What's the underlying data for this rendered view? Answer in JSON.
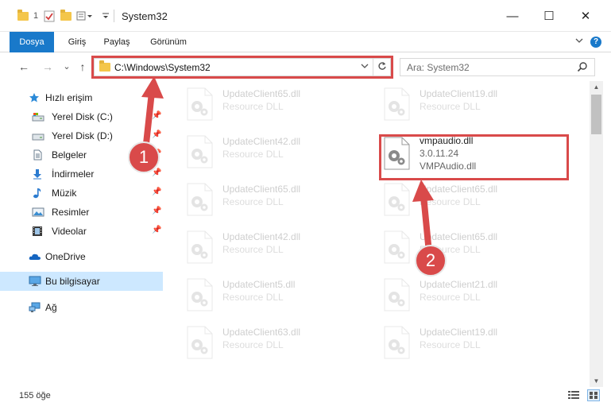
{
  "window": {
    "title": "System32",
    "quick_access_count": "1",
    "minimize_symbol": "—",
    "maximize_symbol": "☐",
    "close_symbol": "✕"
  },
  "ribbon": {
    "tabs": [
      "Dosya",
      "Giriş",
      "Paylaş",
      "Görünüm"
    ],
    "help_symbol": "?"
  },
  "navigation": {
    "back_symbol": "←",
    "forward_symbol": "→",
    "recent_symbol": "⌄",
    "up_symbol": "↑",
    "address": "C:\\Windows\\System32",
    "search_placeholder": "Ara: System32"
  },
  "sidebar": {
    "items": [
      {
        "label": "Hızlı erişim",
        "icon": "star-icon"
      },
      {
        "label": "Yerel Disk (C:)",
        "icon": "drive-icon",
        "pinned": true
      },
      {
        "label": "Yerel Disk (D:)",
        "icon": "drive-icon",
        "pinned": true
      },
      {
        "label": "Belgeler",
        "icon": "documents-icon",
        "pinned": true
      },
      {
        "label": "İndirmeler",
        "icon": "download-icon",
        "pinned": true
      },
      {
        "label": "Müzik",
        "icon": "music-icon",
        "pinned": true
      },
      {
        "label": "Resimler",
        "icon": "pictures-icon",
        "pinned": true
      },
      {
        "label": "Videolar",
        "icon": "videos-icon",
        "pinned": true
      },
      {
        "label": "OneDrive",
        "icon": "cloud-icon"
      },
      {
        "label": "Bu bilgisayar",
        "icon": "computer-icon",
        "selected": true
      },
      {
        "label": "Ağ",
        "icon": "network-icon"
      }
    ]
  },
  "files": {
    "left": [
      {
        "name": "UpdateClient65.dll",
        "desc": "Resource DLL"
      },
      {
        "name": "UpdateClient42.dll",
        "desc": "Resource DLL"
      },
      {
        "name": "UpdateClient65.dll",
        "desc": "Resource DLL"
      },
      {
        "name": "UpdateClient42.dll",
        "desc": "Resource DLL"
      },
      {
        "name": "UpdateClient5.dll",
        "desc": "Resource DLL"
      },
      {
        "name": "UpdateClient63.dll",
        "desc": "Resource DLL"
      }
    ],
    "right": [
      {
        "name": "UpdateClient19.dll",
        "desc": "Resource DLL"
      },
      {
        "name": "vmpaudio.dll",
        "desc": "3.0.11.24",
        "extra": "VMPAudio.dll",
        "highlighted": true
      },
      {
        "name": "UpdateClient65.dll",
        "desc": "Resource DLL"
      },
      {
        "name": "UpdateClient65.dll",
        "desc": "Resource DLL"
      },
      {
        "name": "UpdateClient21.dll",
        "desc": "Resource DLL"
      },
      {
        "name": "UpdateClient19.dll",
        "desc": "Resource DLL"
      }
    ]
  },
  "status": {
    "item_count": "155 öğe"
  },
  "annotations": {
    "badge_1": "1",
    "badge_2": "2",
    "accent_color": "#d94a4a"
  }
}
